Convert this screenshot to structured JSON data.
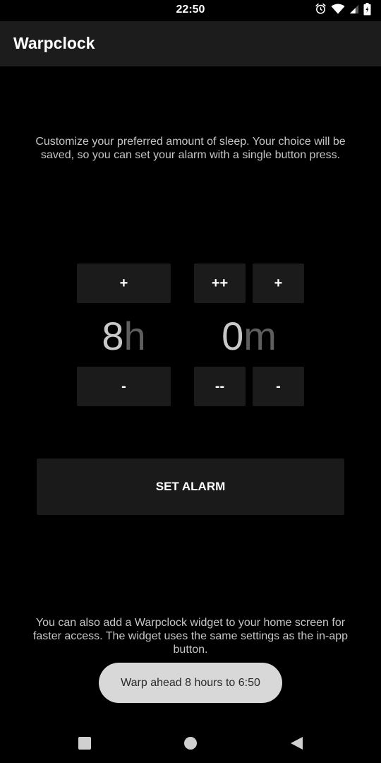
{
  "status_bar": {
    "time": "22:50",
    "icons": [
      "alarm-icon",
      "wifi-icon",
      "signal-icon",
      "battery-icon"
    ]
  },
  "app_bar": {
    "title": "Warpclock"
  },
  "intro": {
    "text": "Customize your preferred amount of sleep. Your choice will be saved, so you can set your alarm with a single button press."
  },
  "hours": {
    "value": "8",
    "unit": "h",
    "increase_label": "+",
    "decrease_label": "-"
  },
  "minutes": {
    "value": "0",
    "unit": "m",
    "increase_big_label": "++",
    "increase_label": "+",
    "decrease_big_label": "--",
    "decrease_label": "-"
  },
  "set_alarm": {
    "label": "SET ALARM"
  },
  "widget_info": {
    "text": "You can also add a Warpclock widget to your home screen for faster access. The widget uses the same settings as the in-app button."
  },
  "toast": {
    "text": "Warp ahead 8 hours to 6:50"
  },
  "nav_bar": {
    "icons": [
      "recents-icon",
      "home-icon",
      "back-icon"
    ]
  },
  "colors": {
    "background": "#000000",
    "app_bar": "#1c1c1c",
    "button": "#1b1b1b",
    "text_secondary": "#c6c6c6",
    "time_number": "#c8c8c8",
    "time_unit": "#5e5e5e",
    "toast_background": "#d8d8d8"
  }
}
